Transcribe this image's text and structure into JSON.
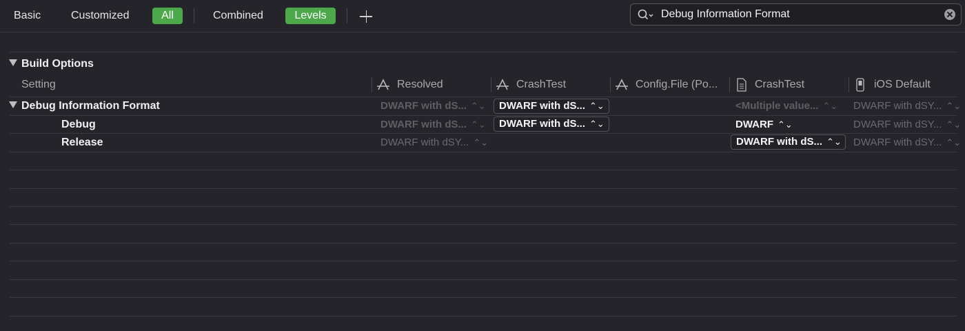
{
  "toolbar": {
    "basic": "Basic",
    "customized": "Customized",
    "all": "All",
    "combined": "Combined",
    "levels": "Levels",
    "add_icon": "plus-icon"
  },
  "search": {
    "value": "Debug Information Format",
    "icon": "search-icon",
    "clear_icon": "clear-icon"
  },
  "colors": {
    "accent": "#4ca84a",
    "background": "#25242a"
  },
  "section": {
    "title": "Build Options"
  },
  "columns": {
    "setting": "Setting",
    "resolved": "Resolved",
    "target": "CrashTest",
    "config_file": "Config.File (Po...",
    "project": "CrashTest",
    "ios_default": "iOS Default"
  },
  "rows": [
    {
      "label": "Debug Information Format",
      "resolved": "DWARF with dS...",
      "target": "DWARF with dS...",
      "project": "<Multiple value...",
      "ios_default": "DWARF with dSY..."
    },
    {
      "label": "Debug",
      "resolved": "DWARF with dS...",
      "target": "DWARF with dS...",
      "project": "DWARF",
      "ios_default": "DWARF with dSY..."
    },
    {
      "label": "Release",
      "resolved": "DWARF with dSY...",
      "project": "DWARF with dS...",
      "ios_default": "DWARF with dSY..."
    }
  ],
  "stepper_glyph": "⌃⌄"
}
